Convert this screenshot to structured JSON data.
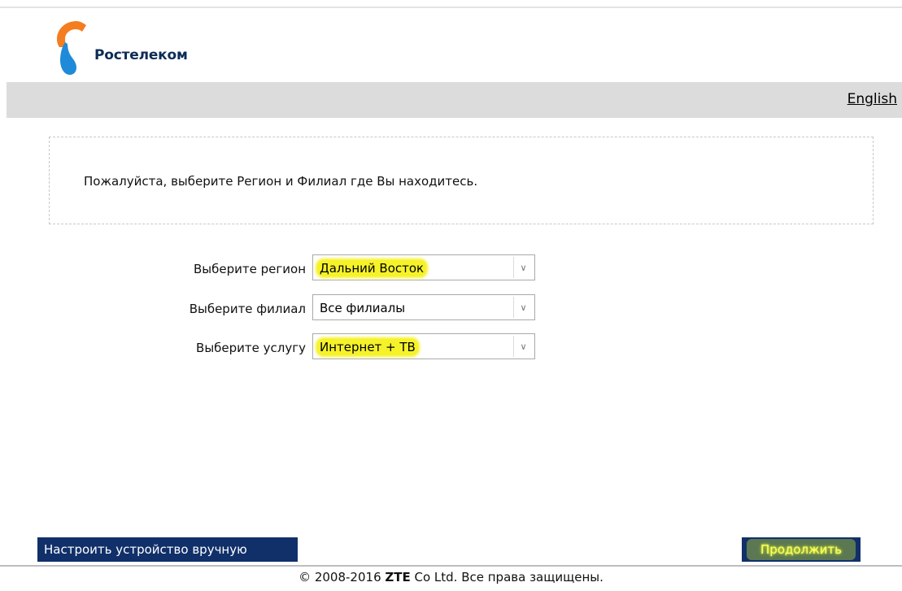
{
  "brand": {
    "name": "Ростелеком",
    "logo_icon": "rostelecom-logo-icon",
    "colors": {
      "orange": "#f47d20",
      "blue": "#1f8bd8",
      "dark_blue": "#11306a",
      "highlight": "#f6f22a"
    }
  },
  "language_link": "English",
  "info": {
    "message": "Пожалуйста, выберите Регион и Филиал где Вы находитесь."
  },
  "form": {
    "region": {
      "label": "Выберите регион",
      "value": "Дальний Восток"
    },
    "branch": {
      "label": "Выберите филиал",
      "value": "Все филиалы"
    },
    "service": {
      "label": "Выберите услугу",
      "value": "Интернет + ТВ"
    }
  },
  "buttons": {
    "manual": "Настроить устройство вручную",
    "continue": "Продолжить"
  },
  "footer": {
    "copyright_prefix": "© 2008-2016 ",
    "company": "ZTE",
    "copyright_suffix": " Co Ltd. Все права защищены."
  }
}
